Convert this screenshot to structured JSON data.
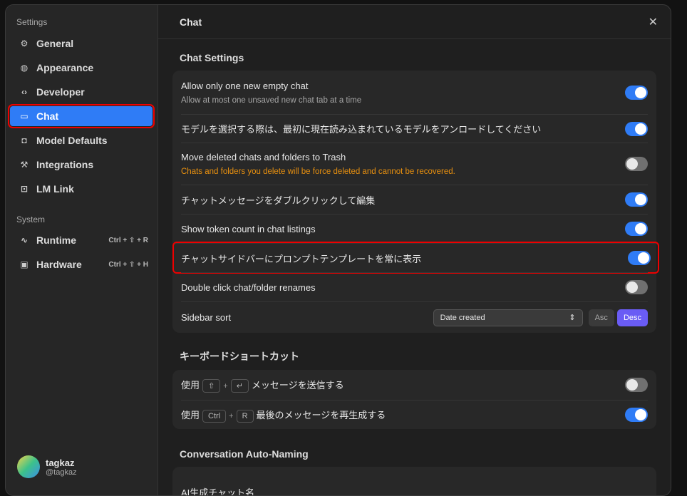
{
  "sidebar": {
    "settings_label": "Settings",
    "system_label": "System",
    "items": [
      {
        "label": "General",
        "icon": "gear-icon"
      },
      {
        "label": "Appearance",
        "icon": "palette-icon"
      },
      {
        "label": "Developer",
        "icon": "code-icon"
      },
      {
        "label": "Chat",
        "icon": "chat-bubble-icon"
      },
      {
        "label": "Model Defaults",
        "icon": "robot-icon"
      },
      {
        "label": "Integrations",
        "icon": "hammer-icon"
      },
      {
        "label": "LM Link",
        "icon": "link-icon"
      }
    ],
    "system_items": [
      {
        "label": "Runtime",
        "shortcut": "Ctrl + ⇧ + R",
        "icon": "activity-icon"
      },
      {
        "label": "Hardware",
        "shortcut": "Ctrl + ⇧ + H",
        "icon": "chip-icon"
      }
    ],
    "user": {
      "name": "tagkaz",
      "handle": "@tagkaz"
    }
  },
  "header": {
    "title": "Chat",
    "close": "✕"
  },
  "chat_settings": {
    "title": "Chat Settings",
    "rows": [
      {
        "label": "Allow only one new empty chat",
        "sub": "Allow at most one unsaved new chat tab at a time",
        "on": true
      },
      {
        "label": "モデルを選択する際は、最初に現在読み込まれているモデルをアンロードしてください",
        "on": true
      },
      {
        "label": "Move deleted chats and folders to Trash",
        "sub": "Chats and folders you delete will be force deleted and cannot be recovered.",
        "on": false
      },
      {
        "label": "チャットメッセージをダブルクリックして編集",
        "on": true
      },
      {
        "label": "Show token count in chat listings",
        "on": true
      },
      {
        "label": "チャットサイドバーにプロンプトテンプレートを常に表示",
        "on": true
      },
      {
        "label": "Double click chat/folder renames",
        "on": false
      }
    ],
    "sort": {
      "label": "Sidebar sort",
      "value": "Date created",
      "asc": "Asc",
      "desc": "Desc"
    }
  },
  "shortcuts": {
    "title": "キーボードショートカット",
    "rows": [
      {
        "prefix": "使用",
        "k1": "⇧",
        "k2": "↵",
        "plus": "+",
        "label": "メッセージを送信する",
        "on": false
      },
      {
        "prefix": "使用",
        "k1": "Ctrl",
        "k2": "R",
        "plus": "+",
        "label": "最後のメッセージを再生成する",
        "on": true
      }
    ]
  },
  "naming": {
    "title": "Conversation Auto-Naming",
    "row": "AI生成チャット名"
  },
  "colors": {
    "accent": "#2f7cf6",
    "desc": "#6a5cf5",
    "warning": "#e8900f"
  }
}
